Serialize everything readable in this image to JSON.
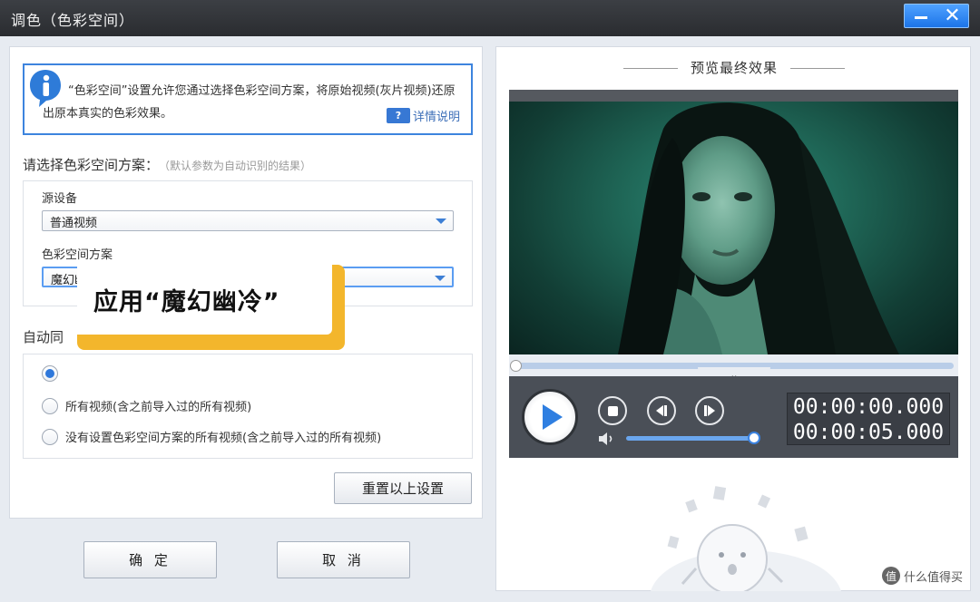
{
  "window": {
    "title": "调色（色彩空间）",
    "minimize_icon": "minimize-icon",
    "close_icon": "close-icon",
    "close_glyph": "✕"
  },
  "info": {
    "text": "“色彩空间”设置允许您通过选择色彩空间方案，将原始视频(灰片视频)还原出原本真实的色彩效果。",
    "detail_link": "详情说明",
    "detail_icon_text": "?",
    "icon": "info-icon"
  },
  "scheme": {
    "label": "请选择色彩空间方案：",
    "hint": "（默认参数为自动识别的结果）",
    "source_device_label": "源设备",
    "source_device_value": "普通视频",
    "color_scheme_label": "色彩空间方案",
    "color_scheme_value": "魔幻幽冷"
  },
  "callout": {
    "text": "应用“魔幻幽冷”"
  },
  "apply_scope": {
    "label": "自动同",
    "options": [
      {
        "label": "",
        "checked": true
      },
      {
        "label": "所有视频(含之前导入过的所有视频)",
        "checked": false
      },
      {
        "label": "没有设置色彩空间方案的所有视频(含之前导入过的所有视频)",
        "checked": false
      }
    ]
  },
  "buttons": {
    "reset": "重置以上设置",
    "ok": "确 定",
    "cancel": "取 消"
  },
  "preview": {
    "title": "预览最终效果",
    "collapse_glyph": "⌄",
    "current_time": "00:00:00.000",
    "total_time": "00:00:05.000",
    "volume_percent": 100,
    "progress_percent": 0
  },
  "watermark": {
    "text": "什么值得买",
    "logo_text": "值"
  },
  "colors": {
    "accent": "#2f78db",
    "callout": "#f3b62c",
    "titlebar": "#2d3035"
  }
}
